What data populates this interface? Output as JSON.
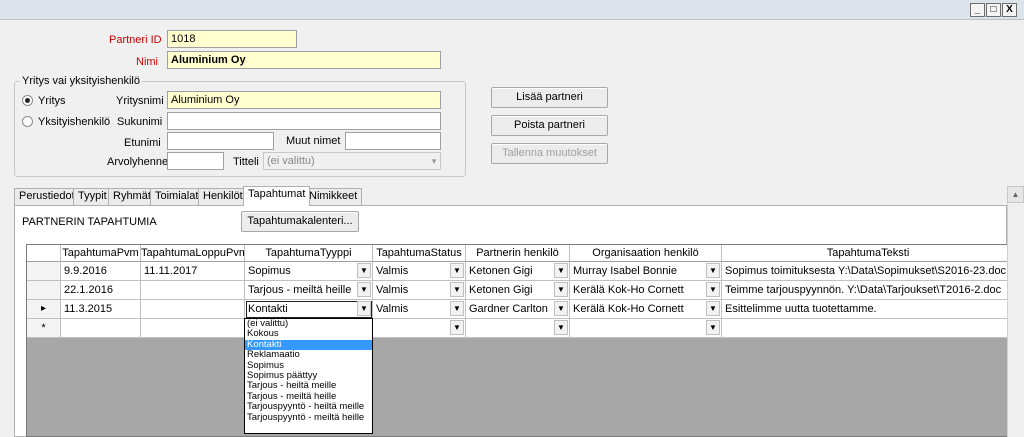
{
  "window": {
    "minimize": "_",
    "maximize": "□",
    "close": "X"
  },
  "form": {
    "partner_id_label": "Partneri ID",
    "partner_id_value": "1018",
    "name_label": "Nimi",
    "name_value": "Aluminium Oy"
  },
  "group": {
    "legend": "Yritys vai yksityishenkilö",
    "radio_company": "Yritys",
    "radio_person": "Yksityishenkilö",
    "company_name_label": "Yritysnimi",
    "company_name_value": "Aluminium Oy",
    "surname_label": "Sukunimi",
    "surname_value": "",
    "firstname_label": "Etunimi",
    "firstname_value": "",
    "other_names_label": "Muut nimet",
    "other_names_value": "",
    "title_abbr_label": "Arvolyhenne",
    "title_abbr_value": "",
    "title_label": "Titteli",
    "title_value": "(ei valittu)"
  },
  "buttons": {
    "add": "Lisää partneri",
    "delete": "Poista partneri",
    "save": "Tallenna muutokset",
    "calendar": "Tapahtumakalenteri..."
  },
  "tabs": [
    {
      "label": "Perustiedot"
    },
    {
      "label": "Tyypit"
    },
    {
      "label": "Ryhmät"
    },
    {
      "label": "Toimialat"
    },
    {
      "label": "Henkilöt"
    },
    {
      "label": "Tapahtumat"
    },
    {
      "label": "Nimikkeet"
    }
  ],
  "panel": {
    "title": "PARTNERIN TAPAHTUMIA"
  },
  "table": {
    "columns": [
      "TapahtumaPvm",
      "TapahtumaLoppuPvm",
      "TapahtumaTyyppi",
      "TapahtumaStatus",
      "Partnerin henkilö",
      "Organisaation henkilö",
      "TapahtumaTeksti"
    ],
    "rows": [
      {
        "marker": "",
        "pvm": "9.9.2016",
        "loppu": "11.11.2017",
        "tyyppi": "Sopimus",
        "status": "Valmis",
        "partneri": "Ketonen Gigi",
        "org": "Murray Isabel Bonnie",
        "teksti": "Sopimus toimituksesta Y:\\Data\\Sopimukset\\S2016-23.doc."
      },
      {
        "marker": "",
        "pvm": "22.1.2016",
        "loppu": "",
        "tyyppi": "Tarjous - meiltä heille",
        "status": "Valmis",
        "partneri": "Ketonen Gigi",
        "org": "Kerälä Kok-Ho Cornett",
        "teksti": "Teimme tarjouspyynnön. Y:\\Data\\Tarjoukset\\T2016-2.doc"
      },
      {
        "marker": "▸",
        "pvm": "11.3.2015",
        "loppu": "",
        "tyyppi": "Kontakti",
        "status": "Valmis",
        "partneri": "Gardner Carlton",
        "org": "Kerälä Kok-Ho Cornett",
        "teksti": "Esittelimme uutta tuotettamme."
      },
      {
        "marker": "*",
        "pvm": "",
        "loppu": "",
        "tyyppi": "",
        "status": "",
        "partneri": "",
        "org": "",
        "teksti": ""
      }
    ]
  },
  "dropdown": {
    "options": [
      {
        "label": "(ei valittu)"
      },
      {
        "label": "Kokous"
      },
      {
        "label": "Kontakti",
        "selected": true
      },
      {
        "label": "Reklamaatio"
      },
      {
        "label": "Sopimus"
      },
      {
        "label": "Sopimus päättyy"
      },
      {
        "label": "Tarjous - heiltä meille"
      },
      {
        "label": "Tarjous - meiltä heille"
      },
      {
        "label": "Tarjouspyyntö - heiltä meille"
      },
      {
        "label": "Tarjouspyyntö - meiltä heille"
      }
    ]
  },
  "icons": {
    "dropdown_arrow": "▼",
    "scroll_up": "▲"
  }
}
